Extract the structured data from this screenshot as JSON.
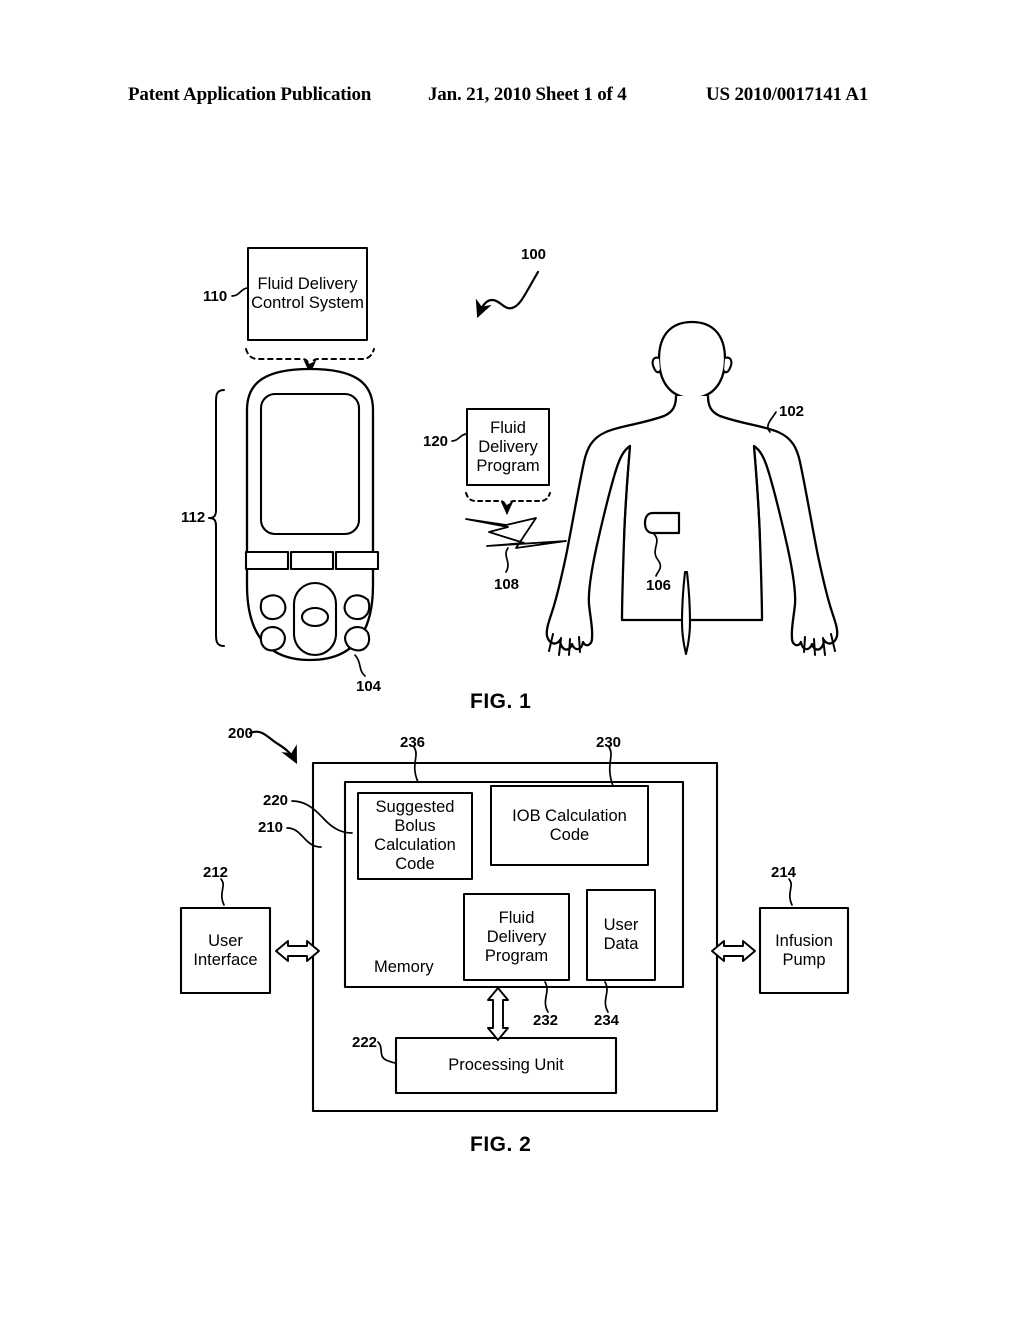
{
  "header": {
    "publication": "Patent Application Publication",
    "date_sheet": "Jan. 21, 2010  Sheet 1 of 4",
    "doc_number": "US 2010/0017141 A1"
  },
  "fig1": {
    "caption": "FIG. 1",
    "system_ref": "100",
    "control_system_box": {
      "text": "Fluid Delivery\nControl System",
      "ref": "110"
    },
    "device": {
      "ref": "104",
      "housing_ref": "112",
      "display_label": "display-screen",
      "soft_buttons": 3,
      "nav_pad": "oval-navigation-pad",
      "side_buttons": 4
    },
    "program_box": {
      "text": "Fluid\nDelivery\nProgram",
      "ref": "120"
    },
    "wireless_signal": {
      "ref": "108",
      "icon": "lightning-bolt-icon"
    },
    "patient": {
      "ref": "102"
    },
    "infusion_patch": {
      "ref": "106"
    }
  },
  "fig2": {
    "caption": "FIG. 2",
    "system_ref": "200",
    "controller_ref": "210",
    "memory_ref": "220",
    "memory_label": "Memory",
    "processing_unit": {
      "label": "Processing Unit",
      "ref": "222"
    },
    "user_interface": {
      "label": "User\nInterface",
      "ref": "212"
    },
    "infusion_pump": {
      "label": "Infusion\nPump",
      "ref": "214"
    },
    "memory_blocks": [
      {
        "label": "Suggested\nBolus\nCalculation\nCode",
        "ref": "236"
      },
      {
        "label": "IOB Calculation\nCode",
        "ref": "230"
      },
      {
        "label": "Fluid\nDelivery\nProgram",
        "ref": "232"
      },
      {
        "label": "User\nData",
        "ref": "234"
      }
    ]
  },
  "colors": {
    "ink": "#000000",
    "paper": "#ffffff"
  }
}
